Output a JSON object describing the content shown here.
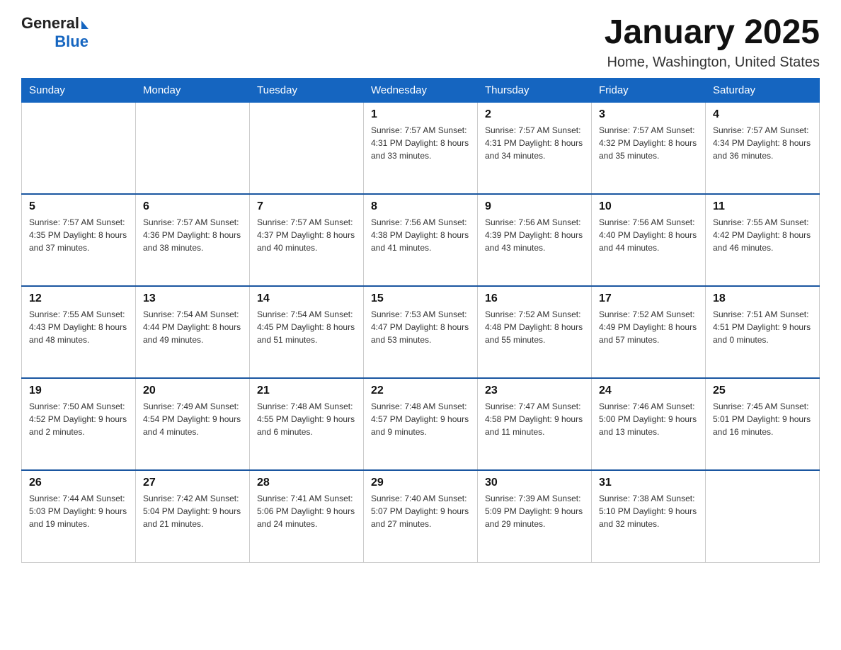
{
  "header": {
    "logo_general": "General",
    "logo_blue": "Blue",
    "title": "January 2025",
    "subtitle": "Home, Washington, United States"
  },
  "days_of_week": [
    "Sunday",
    "Monday",
    "Tuesday",
    "Wednesday",
    "Thursday",
    "Friday",
    "Saturday"
  ],
  "weeks": [
    [
      {
        "day": "",
        "info": ""
      },
      {
        "day": "",
        "info": ""
      },
      {
        "day": "",
        "info": ""
      },
      {
        "day": "1",
        "info": "Sunrise: 7:57 AM\nSunset: 4:31 PM\nDaylight: 8 hours\nand 33 minutes."
      },
      {
        "day": "2",
        "info": "Sunrise: 7:57 AM\nSunset: 4:31 PM\nDaylight: 8 hours\nand 34 minutes."
      },
      {
        "day": "3",
        "info": "Sunrise: 7:57 AM\nSunset: 4:32 PM\nDaylight: 8 hours\nand 35 minutes."
      },
      {
        "day": "4",
        "info": "Sunrise: 7:57 AM\nSunset: 4:34 PM\nDaylight: 8 hours\nand 36 minutes."
      }
    ],
    [
      {
        "day": "5",
        "info": "Sunrise: 7:57 AM\nSunset: 4:35 PM\nDaylight: 8 hours\nand 37 minutes."
      },
      {
        "day": "6",
        "info": "Sunrise: 7:57 AM\nSunset: 4:36 PM\nDaylight: 8 hours\nand 38 minutes."
      },
      {
        "day": "7",
        "info": "Sunrise: 7:57 AM\nSunset: 4:37 PM\nDaylight: 8 hours\nand 40 minutes."
      },
      {
        "day": "8",
        "info": "Sunrise: 7:56 AM\nSunset: 4:38 PM\nDaylight: 8 hours\nand 41 minutes."
      },
      {
        "day": "9",
        "info": "Sunrise: 7:56 AM\nSunset: 4:39 PM\nDaylight: 8 hours\nand 43 minutes."
      },
      {
        "day": "10",
        "info": "Sunrise: 7:56 AM\nSunset: 4:40 PM\nDaylight: 8 hours\nand 44 minutes."
      },
      {
        "day": "11",
        "info": "Sunrise: 7:55 AM\nSunset: 4:42 PM\nDaylight: 8 hours\nand 46 minutes."
      }
    ],
    [
      {
        "day": "12",
        "info": "Sunrise: 7:55 AM\nSunset: 4:43 PM\nDaylight: 8 hours\nand 48 minutes."
      },
      {
        "day": "13",
        "info": "Sunrise: 7:54 AM\nSunset: 4:44 PM\nDaylight: 8 hours\nand 49 minutes."
      },
      {
        "day": "14",
        "info": "Sunrise: 7:54 AM\nSunset: 4:45 PM\nDaylight: 8 hours\nand 51 minutes."
      },
      {
        "day": "15",
        "info": "Sunrise: 7:53 AM\nSunset: 4:47 PM\nDaylight: 8 hours\nand 53 minutes."
      },
      {
        "day": "16",
        "info": "Sunrise: 7:52 AM\nSunset: 4:48 PM\nDaylight: 8 hours\nand 55 minutes."
      },
      {
        "day": "17",
        "info": "Sunrise: 7:52 AM\nSunset: 4:49 PM\nDaylight: 8 hours\nand 57 minutes."
      },
      {
        "day": "18",
        "info": "Sunrise: 7:51 AM\nSunset: 4:51 PM\nDaylight: 9 hours\nand 0 minutes."
      }
    ],
    [
      {
        "day": "19",
        "info": "Sunrise: 7:50 AM\nSunset: 4:52 PM\nDaylight: 9 hours\nand 2 minutes."
      },
      {
        "day": "20",
        "info": "Sunrise: 7:49 AM\nSunset: 4:54 PM\nDaylight: 9 hours\nand 4 minutes."
      },
      {
        "day": "21",
        "info": "Sunrise: 7:48 AM\nSunset: 4:55 PM\nDaylight: 9 hours\nand 6 minutes."
      },
      {
        "day": "22",
        "info": "Sunrise: 7:48 AM\nSunset: 4:57 PM\nDaylight: 9 hours\nand 9 minutes."
      },
      {
        "day": "23",
        "info": "Sunrise: 7:47 AM\nSunset: 4:58 PM\nDaylight: 9 hours\nand 11 minutes."
      },
      {
        "day": "24",
        "info": "Sunrise: 7:46 AM\nSunset: 5:00 PM\nDaylight: 9 hours\nand 13 minutes."
      },
      {
        "day": "25",
        "info": "Sunrise: 7:45 AM\nSunset: 5:01 PM\nDaylight: 9 hours\nand 16 minutes."
      }
    ],
    [
      {
        "day": "26",
        "info": "Sunrise: 7:44 AM\nSunset: 5:03 PM\nDaylight: 9 hours\nand 19 minutes."
      },
      {
        "day": "27",
        "info": "Sunrise: 7:42 AM\nSunset: 5:04 PM\nDaylight: 9 hours\nand 21 minutes."
      },
      {
        "day": "28",
        "info": "Sunrise: 7:41 AM\nSunset: 5:06 PM\nDaylight: 9 hours\nand 24 minutes."
      },
      {
        "day": "29",
        "info": "Sunrise: 7:40 AM\nSunset: 5:07 PM\nDaylight: 9 hours\nand 27 minutes."
      },
      {
        "day": "30",
        "info": "Sunrise: 7:39 AM\nSunset: 5:09 PM\nDaylight: 9 hours\nand 29 minutes."
      },
      {
        "day": "31",
        "info": "Sunrise: 7:38 AM\nSunset: 5:10 PM\nDaylight: 9 hours\nand 32 minutes."
      },
      {
        "day": "",
        "info": ""
      }
    ]
  ]
}
